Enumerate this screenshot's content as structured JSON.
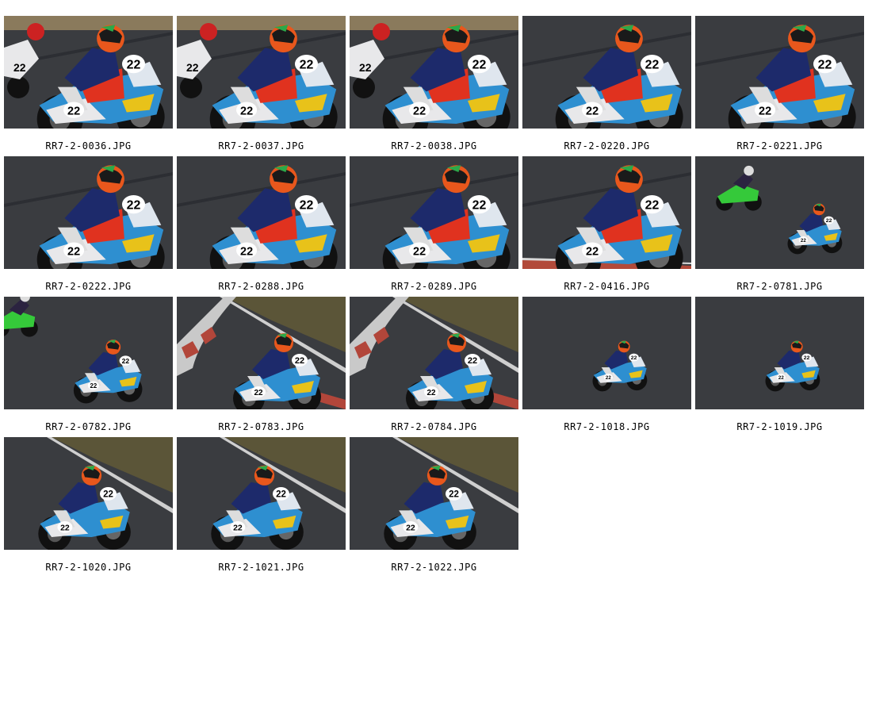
{
  "gallery": {
    "photos": [
      {
        "filename": "RR7-2-0036.JPG",
        "scene": "closeup-pack"
      },
      {
        "filename": "RR7-2-0037.JPG",
        "scene": "closeup-pack"
      },
      {
        "filename": "RR7-2-0038.JPG",
        "scene": "closeup-pack"
      },
      {
        "filename": "RR7-2-0220.JPG",
        "scene": "closeup"
      },
      {
        "filename": "RR7-2-0221.JPG",
        "scene": "closeup"
      },
      {
        "filename": "RR7-2-0222.JPG",
        "scene": "closeup"
      },
      {
        "filename": "RR7-2-0288.JPG",
        "scene": "closeup"
      },
      {
        "filename": "RR7-2-0289.JPG",
        "scene": "closeup"
      },
      {
        "filename": "RR7-2-0416.JPG",
        "scene": "closeup-kerb"
      },
      {
        "filename": "RR7-2-0781.JPG",
        "scene": "far-green-rival"
      },
      {
        "filename": "RR7-2-0782.JPG",
        "scene": "mid-green-rival"
      },
      {
        "filename": "RR7-2-0783.JPG",
        "scene": "kerb-grass"
      },
      {
        "filename": "RR7-2-0784.JPG",
        "scene": "kerb-grass"
      },
      {
        "filename": "RR7-2-1018.JPG",
        "scene": "far"
      },
      {
        "filename": "RR7-2-1019.JPG",
        "scene": "far"
      },
      {
        "filename": "RR7-2-1020.JPG",
        "scene": "mid-grass"
      },
      {
        "filename": "RR7-2-1021.JPG",
        "scene": "mid-grass"
      },
      {
        "filename": "RR7-2-1022.JPG",
        "scene": "mid-grass"
      }
    ],
    "bike_number": "22",
    "colors": {
      "asphalt": "#3a3c40",
      "grass": "#5b5538",
      "fairing_blue": "#2e8fd0",
      "fairing_red": "#e0321f",
      "fairing_yellow": "#e8c21a",
      "rival_green": "#35c93a",
      "helmet_orange": "#e8571c"
    }
  }
}
